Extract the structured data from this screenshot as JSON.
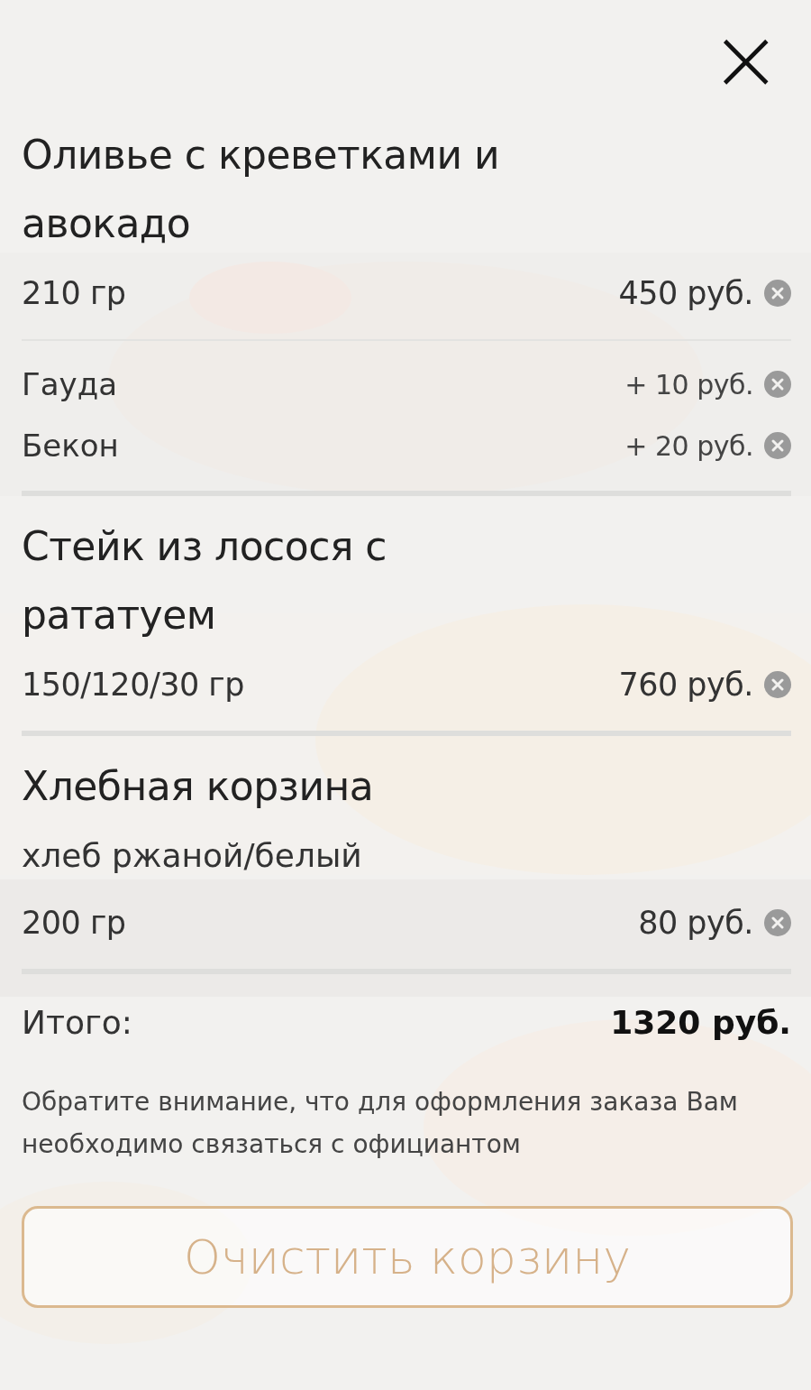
{
  "close_button": {
    "label": "×"
  },
  "items": [
    {
      "name": "Оливье с креветками и авокадо",
      "weight": "210 гр",
      "price": "450 руб.",
      "modifiers": [
        {
          "name": "Гауда",
          "price": "+ 10 руб."
        },
        {
          "name": "Бекон",
          "price": "+ 20 руб."
        }
      ]
    },
    {
      "name": "Стейк из лосося с рататуем",
      "weight": "150/120/30 гр",
      "price": "760 руб."
    },
    {
      "name": "Хлебная корзина",
      "description": "хлеб ржаной/белый",
      "weight": "200 гр",
      "price": "80 руб."
    }
  ],
  "total": {
    "label": "Итого:",
    "value": "1320 руб."
  },
  "note": "Обратите внимание, что для оформления заказа Вам необходимо связаться с официантом",
  "clear_button": {
    "label": "Очистить корзину"
  }
}
